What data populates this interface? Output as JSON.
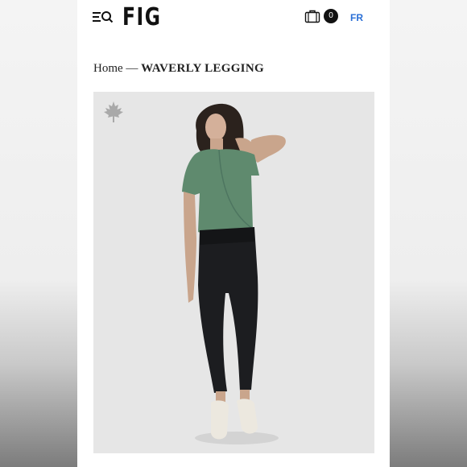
{
  "header": {
    "logo": "FIG",
    "cart_count": "0",
    "language": "FR",
    "icons": [
      "menu-icon",
      "search-icon",
      "shopping-bag-icon"
    ]
  },
  "breadcrumb": {
    "home": "Home",
    "separator": " — ",
    "current": "WAVERLY LEGGING"
  },
  "product": {
    "badge_icon": "maple-leaf-icon",
    "colors": {
      "top": "#5f8a6e",
      "legging": "#1c1d20",
      "shoes": "#ece8df",
      "link": "#2a6fd6"
    }
  }
}
